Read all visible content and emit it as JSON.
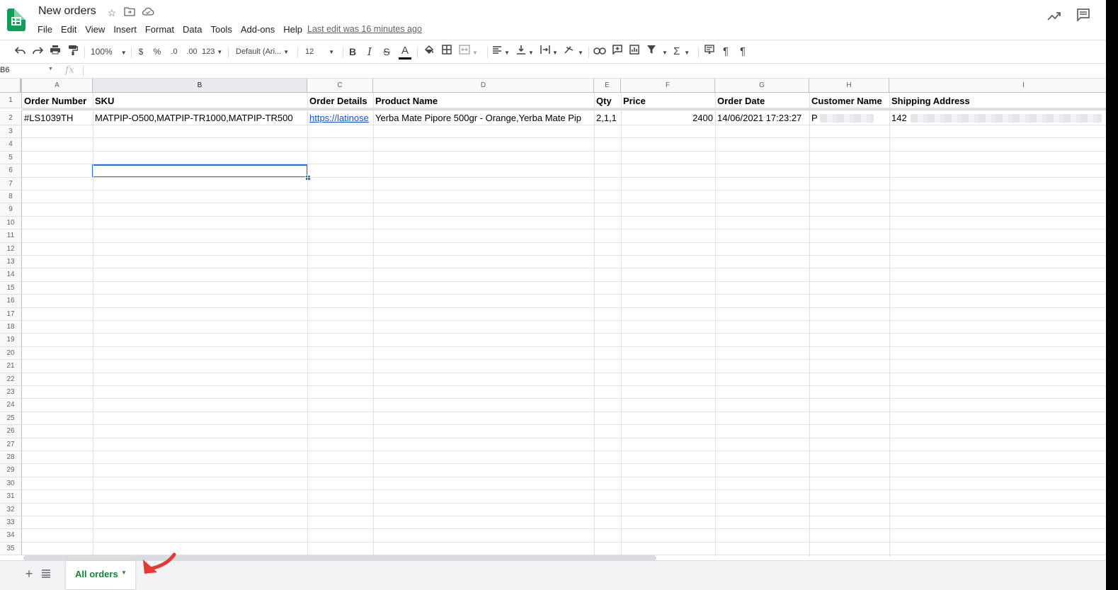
{
  "app": {
    "title": "New orders",
    "last_edit": "Last edit was 16 minutes ago",
    "menu": [
      "File",
      "Edit",
      "View",
      "Insert",
      "Format",
      "Data",
      "Tools",
      "Add-ons",
      "Help"
    ]
  },
  "toolbar": {
    "zoom": "100%",
    "currency": "$",
    "percent": "%",
    "dec_decrease": ".0",
    "dec_increase": ".00",
    "more_formats": "123",
    "font": "Default (Ari...",
    "font_size": "12",
    "bold": "B",
    "italic": "I",
    "strike": "S",
    "text_color": "A",
    "sum": "Σ"
  },
  "formula_bar": {
    "name_box": "B6",
    "fx": "fx"
  },
  "sheet": {
    "columns": [
      "A",
      "B",
      "C",
      "D",
      "E",
      "F",
      "G",
      "H",
      "I"
    ],
    "header_row": [
      "Order Number",
      "SKU",
      "Order Details",
      "Product Name",
      "Qty",
      "Price",
      "Order Date",
      "Customer Name",
      "Shipping Address"
    ],
    "data_row": {
      "order_number": "#LS1039TH",
      "sku": "MATPIP-O500,MATPIP-TR1000,MATPIP-TR500",
      "order_details": "https://latinose",
      "product_name": "Yerba Mate Pipore 500gr - Orange,Yerba Mate Pip",
      "qty": "2,1,1",
      "price": "2400",
      "order_date": "14/06/2021 17:23:27",
      "customer_name": "P",
      "shipping_address": "142"
    },
    "row_numbers": [
      "1",
      "2",
      "3",
      "4",
      "5",
      "6",
      "7",
      "8",
      "9",
      "10",
      "11",
      "12",
      "13",
      "14",
      "15",
      "16",
      "17",
      "18",
      "19",
      "20",
      "21",
      "22",
      "23",
      "24",
      "25",
      "26",
      "27",
      "28",
      "29",
      "30",
      "31",
      "32",
      "33",
      "34",
      "35"
    ],
    "selected_cell": "B6",
    "selection_color": "#1a73e8"
  },
  "tabs": {
    "sheet_tab": "All orders",
    "add_icon": "+",
    "accent": "#188038"
  },
  "annotation": {
    "arrow_color": "#e53935"
  }
}
